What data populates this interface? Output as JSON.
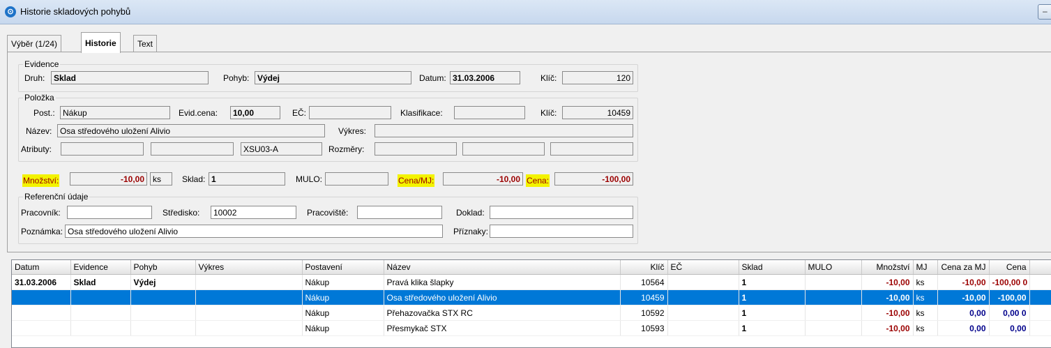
{
  "window": {
    "title": "Historie skladových pohybů",
    "min_label": "–"
  },
  "tabs": [
    "Výběr (1/24)",
    "Historie",
    "Text"
  ],
  "evidence": {
    "legend": "Evidence",
    "druh_label": "Druh:",
    "druh": "Sklad",
    "pohyb_label": "Pohyb:",
    "pohyb": "Výdej",
    "datum_label": "Datum:",
    "datum": "31.03.2006",
    "klic_label": "Klíč:",
    "klic": "120"
  },
  "polozka": {
    "legend": "Položka",
    "post_label": "Post.:",
    "post": "Nákup",
    "evid_cena_label": "Evid.cena:",
    "evid_cena": "10,00",
    "ec_label": "EČ:",
    "ec": "",
    "klasifikace_label": "Klasifikace:",
    "klasifikace": "",
    "klic_label": "Klíč:",
    "klic": "10459",
    "nazev_label": "Název:",
    "nazev": "Osa středového uložení Alivio",
    "vykres_label": "Výkres:",
    "vykres": "",
    "atributy_label": "Atributy:",
    "atr1": "",
    "atr2": "",
    "atr3": "XSU03-A",
    "rozmery_label": "Rozměry:",
    "roz1": "",
    "roz2": "",
    "roz3": ""
  },
  "mnozstvi": {
    "label": "Množství:",
    "value": "-10,00",
    "unit": "ks",
    "sklad_label": "Sklad:",
    "sklad": "1",
    "mulo_label": "MULO:",
    "mulo": "",
    "cena_mj_label": "Cena/MJ:",
    "cena_mj": "-10,00",
    "cena_label": "Cena:",
    "cena": "-100,00"
  },
  "referencni": {
    "legend": "Referenční údaje",
    "pracovnik_label": "Pracovník:",
    "pracovnik": "",
    "stredisko_label": "Středisko:",
    "stredisko": "10002",
    "pracoviste_label": "Pracoviště:",
    "pracoviste": "",
    "doklad_label": "Doklad:",
    "doklad": "",
    "poznamka_label": "Poznámka:",
    "poznamka": "Osa středového uložení Alivio",
    "priznaky_label": "Příznaky:",
    "priznaky": ""
  },
  "grid": {
    "columns": [
      "Datum",
      "Evidence",
      "Pohyb",
      "Výkres",
      "Postavení",
      "Název",
      "Klíč",
      "EČ",
      "Sklad",
      "MULO",
      "Množství",
      "MJ",
      "Cena za MJ",
      "Cena",
      ""
    ],
    "rows": [
      [
        "31.03.2006",
        "Sklad",
        "Výdej",
        "",
        "Nákup",
        "Pravá klika šlapky",
        "10564",
        "",
        "1",
        "",
        "-10,00",
        "ks",
        "-10,00",
        "-100,00 0",
        ""
      ],
      [
        "",
        "",
        "",
        "",
        "Nákup",
        "Osa středového uložení Alivio",
        "10459",
        "",
        "1",
        "",
        "-10,00",
        "ks",
        "-10,00",
        "-100,00",
        ""
      ],
      [
        "",
        "",
        "",
        "",
        "Nákup",
        "Přehazovačka STX RC",
        "10592",
        "",
        "1",
        "",
        "-10,00",
        "ks",
        "0,00",
        "0,00 0",
        ""
      ],
      [
        "",
        "",
        "",
        "",
        "Nákup",
        "Přesmykač STX",
        "10593",
        "",
        "1",
        "",
        "-10,00",
        "ks",
        "0,00",
        "0,00",
        ""
      ]
    ],
    "selected_row": 1
  }
}
